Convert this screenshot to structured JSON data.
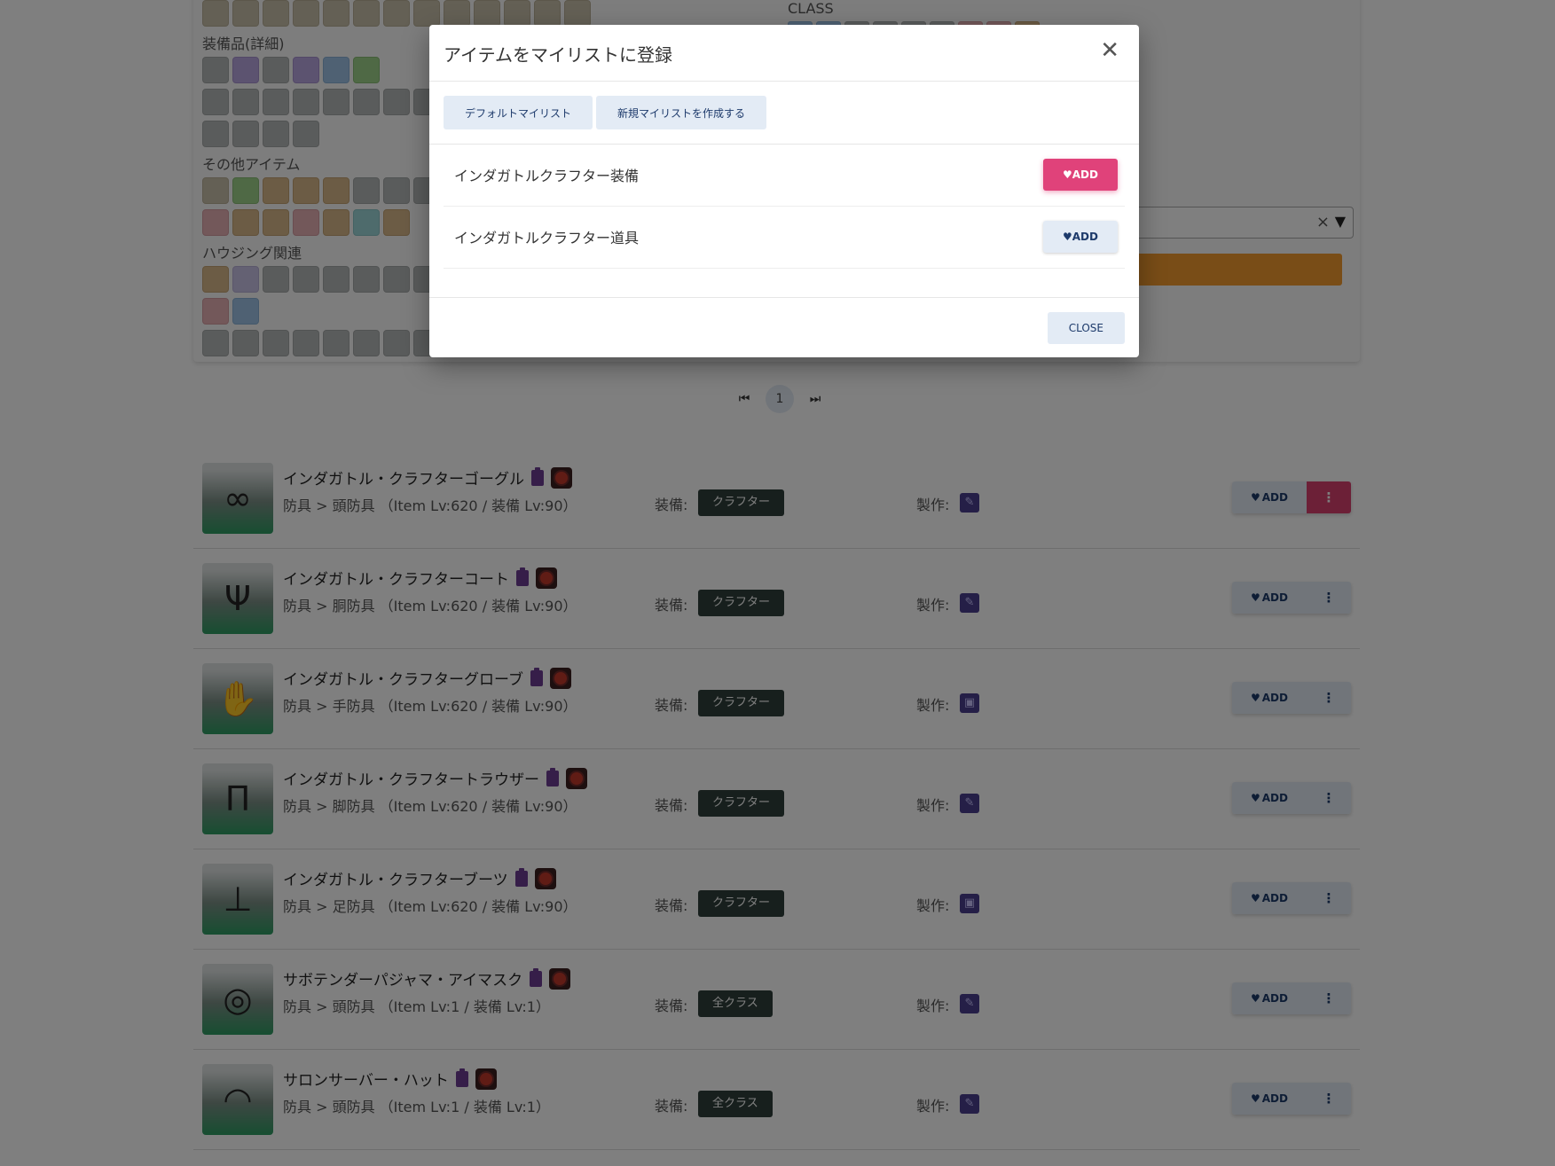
{
  "filter": {
    "section_equipment_detail": "装備品(詳細)",
    "section_other_items": "その他アイテム",
    "section_housing": "ハウジング関連",
    "class_label": "CLASS"
  },
  "pagination": {
    "first_icon": "first-page-icon",
    "last_icon": "last-page-icon",
    "current_page": "1"
  },
  "items": [
    {
      "name": "インダガトル・クラフターゴーグル",
      "sub": "防具 > 頭防具 （Item Lv:620 / 装備 Lv:90）",
      "equip_label": "装備:",
      "equip": "クラフター",
      "craft_label": "製作:",
      "add": "ADD",
      "glyph": "∞"
    },
    {
      "name": "インダガトル・クラフターコート",
      "sub": "防具 > 胴防具 （Item Lv:620 / 装備 Lv:90）",
      "equip_label": "装備:",
      "equip": "クラフター",
      "craft_label": "製作:",
      "add": "ADD",
      "glyph": "Ψ"
    },
    {
      "name": "インダガトル・クラフターグローブ",
      "sub": "防具 > 手防具 （Item Lv:620 / 装備 Lv:90）",
      "equip_label": "装備:",
      "equip": "クラフター",
      "craft_label": "製作:",
      "add": "ADD",
      "glyph": "✋"
    },
    {
      "name": "インダガトル・クラフタートラウザー",
      "sub": "防具 > 脚防具 （Item Lv:620 / 装備 Lv:90）",
      "equip_label": "装備:",
      "equip": "クラフター",
      "craft_label": "製作:",
      "add": "ADD",
      "glyph": "Π"
    },
    {
      "name": "インダガトル・クラフターブーツ",
      "sub": "防具 > 足防具 （Item Lv:620 / 装備 Lv:90）",
      "equip_label": "装備:",
      "equip": "クラフター",
      "craft_label": "製作:",
      "add": "ADD",
      "glyph": "⊥"
    },
    {
      "name": "サボテンダーパジャマ・アイマスク",
      "sub": "防具 > 頭防具 （Item Lv:1 / 装備 Lv:1）",
      "equip_label": "装備:",
      "equip": "全クラス",
      "craft_label": "製作:",
      "add": "ADD",
      "glyph": "◎"
    },
    {
      "name": "サロンサーバー・ハット",
      "sub": "防具 > 頭防具 （Item Lv:1 / 装備 Lv:1）",
      "equip_label": "装備:",
      "equip": "全クラス",
      "craft_label": "製作:",
      "add": "ADD",
      "glyph": "◠"
    }
  ],
  "modal": {
    "title": "アイテムをマイリストに登録",
    "tabs": [
      "デフォルトマイリスト",
      "新規マイリストを作成する"
    ],
    "lists": [
      {
        "name": "インダガトルクラフター装備",
        "add": "ADD"
      },
      {
        "name": "インダガトルクラフター道具",
        "add": "ADD"
      }
    ],
    "close": "CLOSE"
  },
  "colors": {
    "accent_pink": "#e0427a",
    "button_bg": "#e3ebf5",
    "equip_badge": "#2f3f3a",
    "search_orange": "#f29a2e"
  }
}
